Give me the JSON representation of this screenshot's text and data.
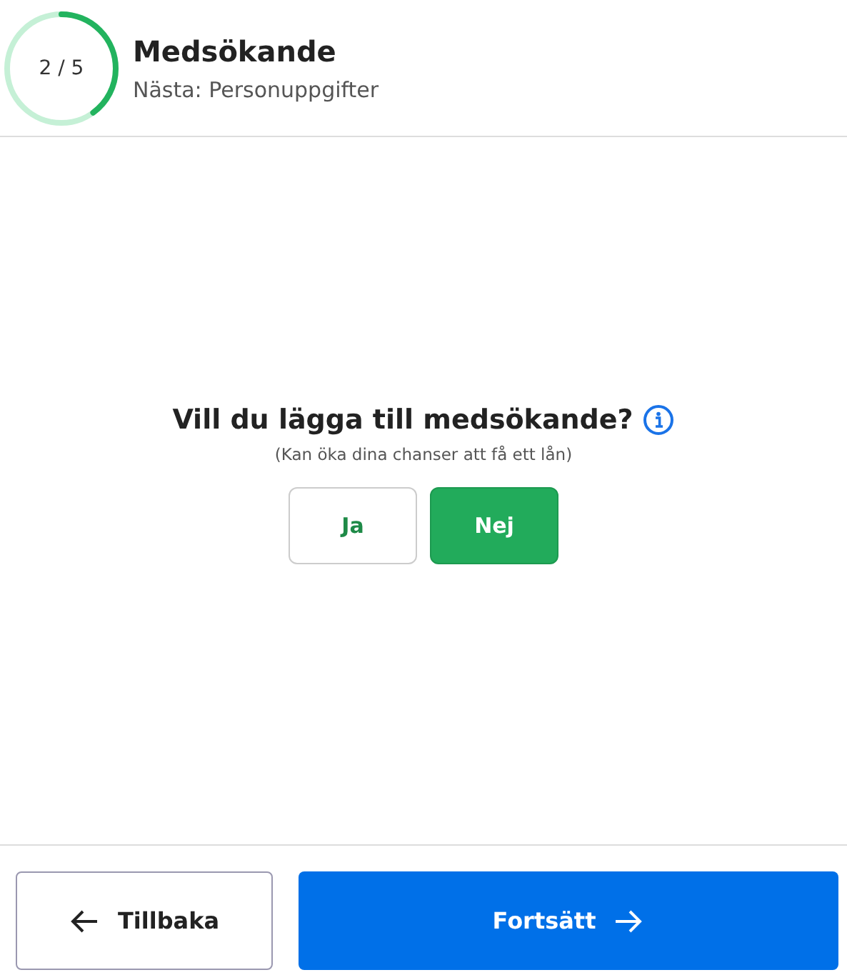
{
  "header": {
    "progress": {
      "text": "2 / 5",
      "level": 0.4
    },
    "title": "Medsökande",
    "subtitle": "Nästa: Personuppgifter"
  },
  "question": {
    "text": "Vill du lägga till medsökande?",
    "hint": "(Kan öka dina chanser att få ett lån)",
    "options": [
      {
        "label": "Ja",
        "selected": false
      },
      {
        "label": "Nej",
        "selected": true
      }
    ]
  },
  "footer": {
    "back": "Tillbaka",
    "next": "Fortsätt"
  }
}
